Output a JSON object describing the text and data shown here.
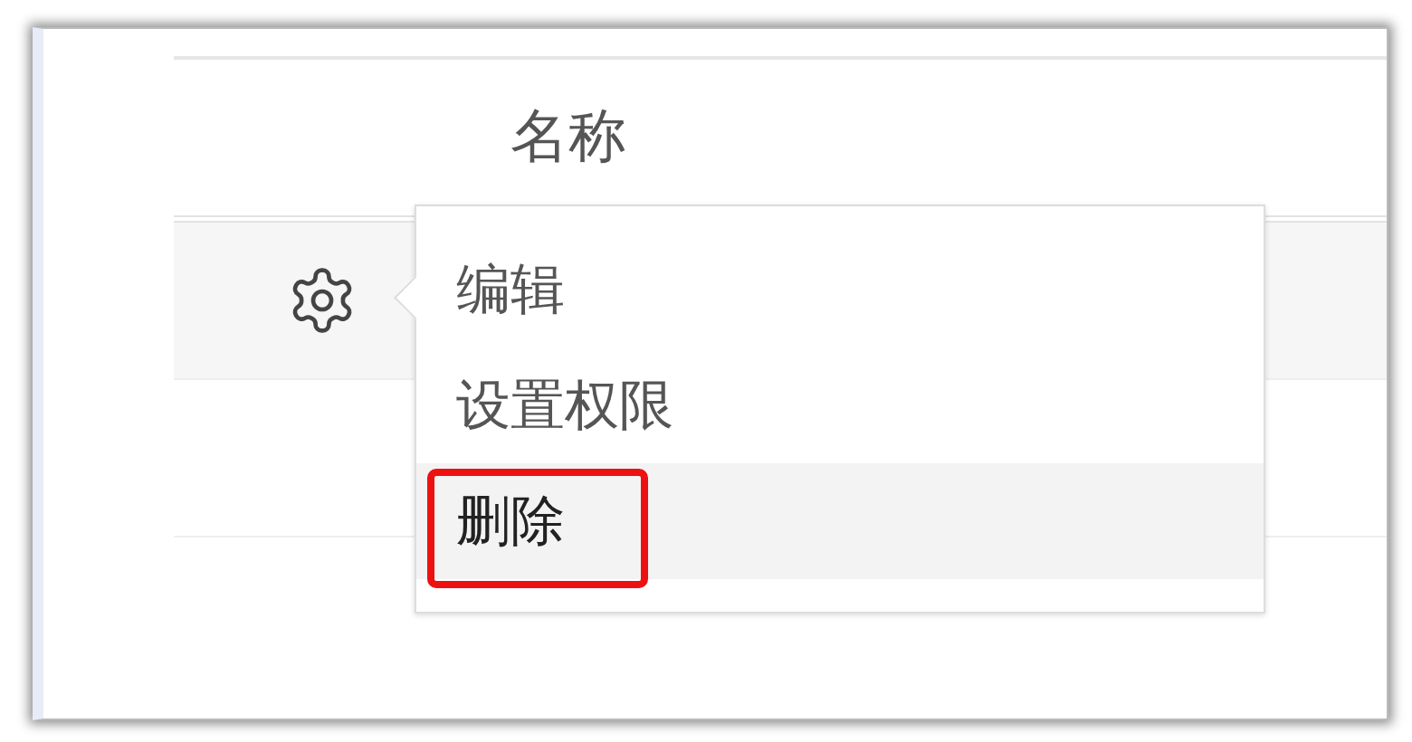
{
  "table": {
    "columns": [
      {
        "label": "名称"
      }
    ],
    "rows": [
      {
        "hovered": true
      },
      {
        "hovered": false
      }
    ]
  },
  "menu": {
    "items": [
      {
        "label": "编辑",
        "hovered": false,
        "annotated": false
      },
      {
        "label": "设置权限",
        "hovered": false,
        "annotated": false
      },
      {
        "label": "删除",
        "hovered": true,
        "annotated": true
      }
    ]
  }
}
